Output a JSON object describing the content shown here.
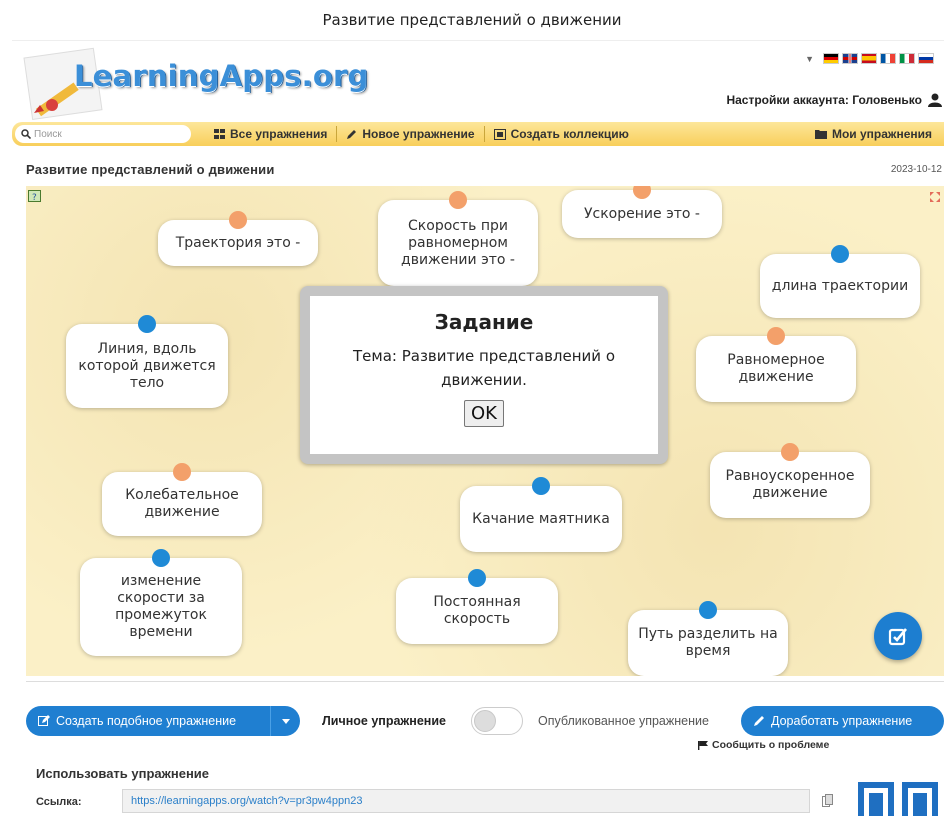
{
  "caption": "Развитие представлений о движении",
  "header": {
    "logo": "LearningApps.org",
    "account": "Настройки аккаунта: Головенько"
  },
  "navbar": {
    "search_placeholder": "Поиск",
    "all_exercises": "Все упражнения",
    "new_exercise": "Новое упражнение",
    "create_collection": "Создать коллекцию",
    "my_exercises": "Мои упражнения"
  },
  "page": {
    "title": "Развитие представлений о движении",
    "date": "2023-10-12"
  },
  "cards": [
    {
      "text": "Траектория это -",
      "dot": "orange"
    },
    {
      "text": "Скорость при равномерном движении это -",
      "dot": "orange"
    },
    {
      "text": "Ускорение это -",
      "dot": "orange"
    },
    {
      "text": "длина траектории",
      "dot": "blue"
    },
    {
      "text": "Линия, вдоль которой движется тело",
      "dot": "blue"
    },
    {
      "text": "Равномерное движение",
      "dot": "orange"
    },
    {
      "text": "Равноускоренное движение",
      "dot": "orange"
    },
    {
      "text": "Колебательное движение",
      "dot": "orange"
    },
    {
      "text": "Качание маятника",
      "dot": "blue"
    },
    {
      "text": "изменение скорости за промежуток времени",
      "dot": "blue"
    },
    {
      "text": "Постоянная скорость",
      "dot": "blue"
    },
    {
      "text": "Путь разделить на время",
      "dot": "blue"
    }
  ],
  "modal": {
    "title": "Задание",
    "body": "Тема: Развитие представлений о движении.",
    "ok": "OK"
  },
  "actions": {
    "create_similar": "Создать подобное упражнение",
    "private_label": "Личное упражнение",
    "public_label": "Опубликованное упражнение",
    "improve": "Доработать упражнение"
  },
  "use": {
    "title": "Использовать упражнение",
    "report": "Сообщить о проблеме",
    "link_label": "Ссылка:",
    "link": "https://learningapps.org/watch?v=pr3pw4ppn23"
  },
  "colors": {
    "accent_blue": "#1f7fd1",
    "dot_orange": "#f3a06a",
    "dot_blue": "#1f8ad6",
    "nav_yellow": "#f8cf5b",
    "board_bg": "#fbf0c7"
  },
  "icons": [
    "search-icon",
    "grid-icon",
    "pencil-icon",
    "collection-icon",
    "folder-icon",
    "user-icon",
    "help-icon",
    "fullscreen-icon",
    "check-icon",
    "edit-icon",
    "flag-icon",
    "copy-icon",
    "chevron-down-icon"
  ]
}
